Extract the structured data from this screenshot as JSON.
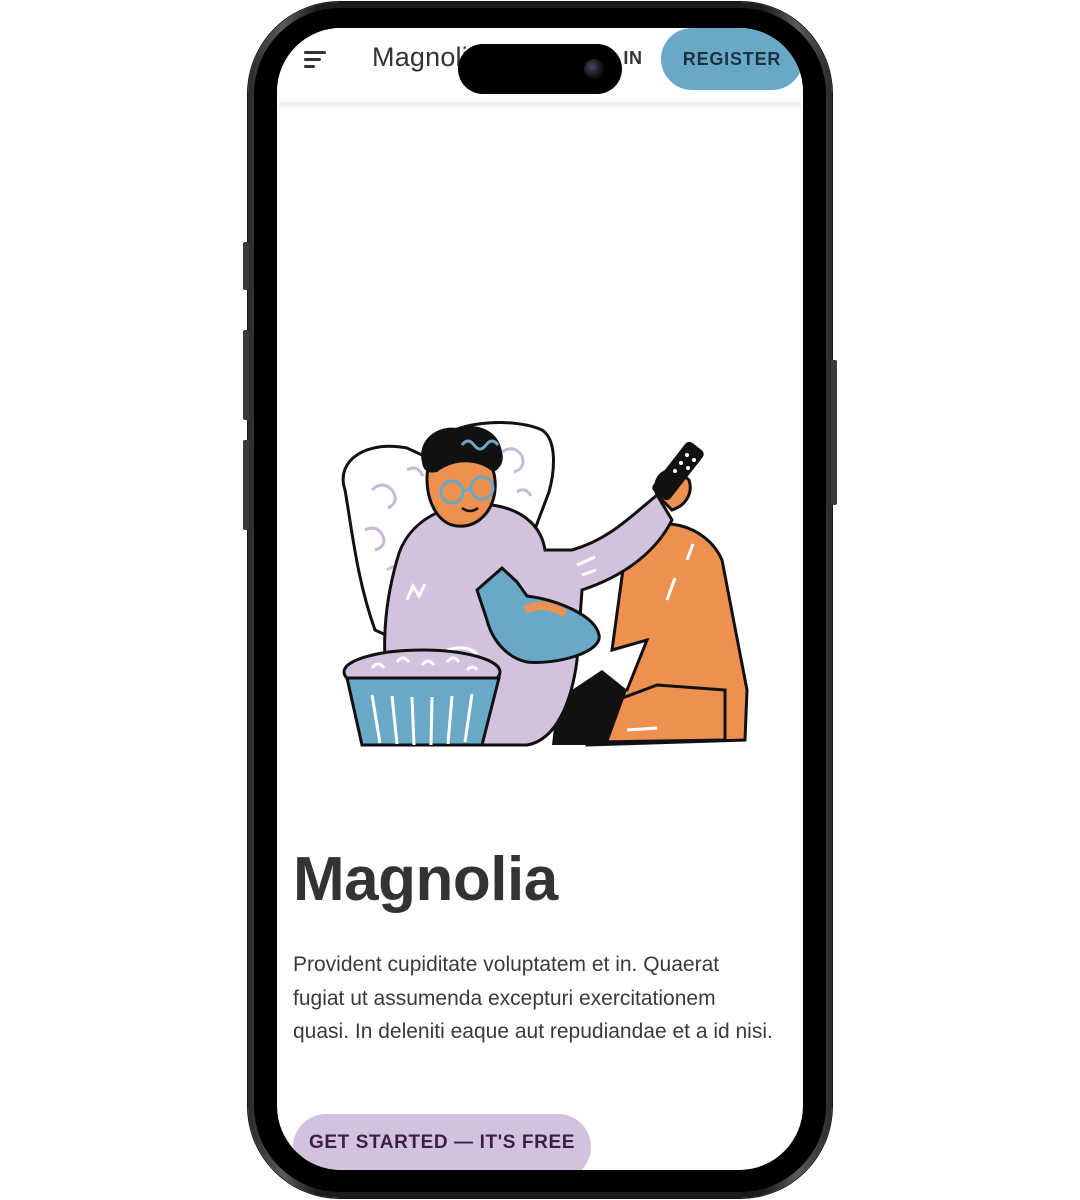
{
  "navbar": {
    "brand": "Magnolia",
    "login_label": "LOG IN",
    "register_label": "REGISTER"
  },
  "hero": {
    "title": "Magnolia",
    "description": "Provident cupiditate voluptatem et in. Quaerat fugiat ut assumenda excepturi exercitationem quasi. In deleniti eaque aut repudiandae et a id nisi.",
    "cta_label": "GET STARTED — IT'S FREE"
  },
  "colors": {
    "accent_blue": "#6aa8c8",
    "accent_lilac": "#d3c2dd",
    "accent_orange": "#ee9150",
    "text_dark": "#333333"
  },
  "icons": {
    "menu": "menu-icon",
    "camera": "camera-icon"
  }
}
